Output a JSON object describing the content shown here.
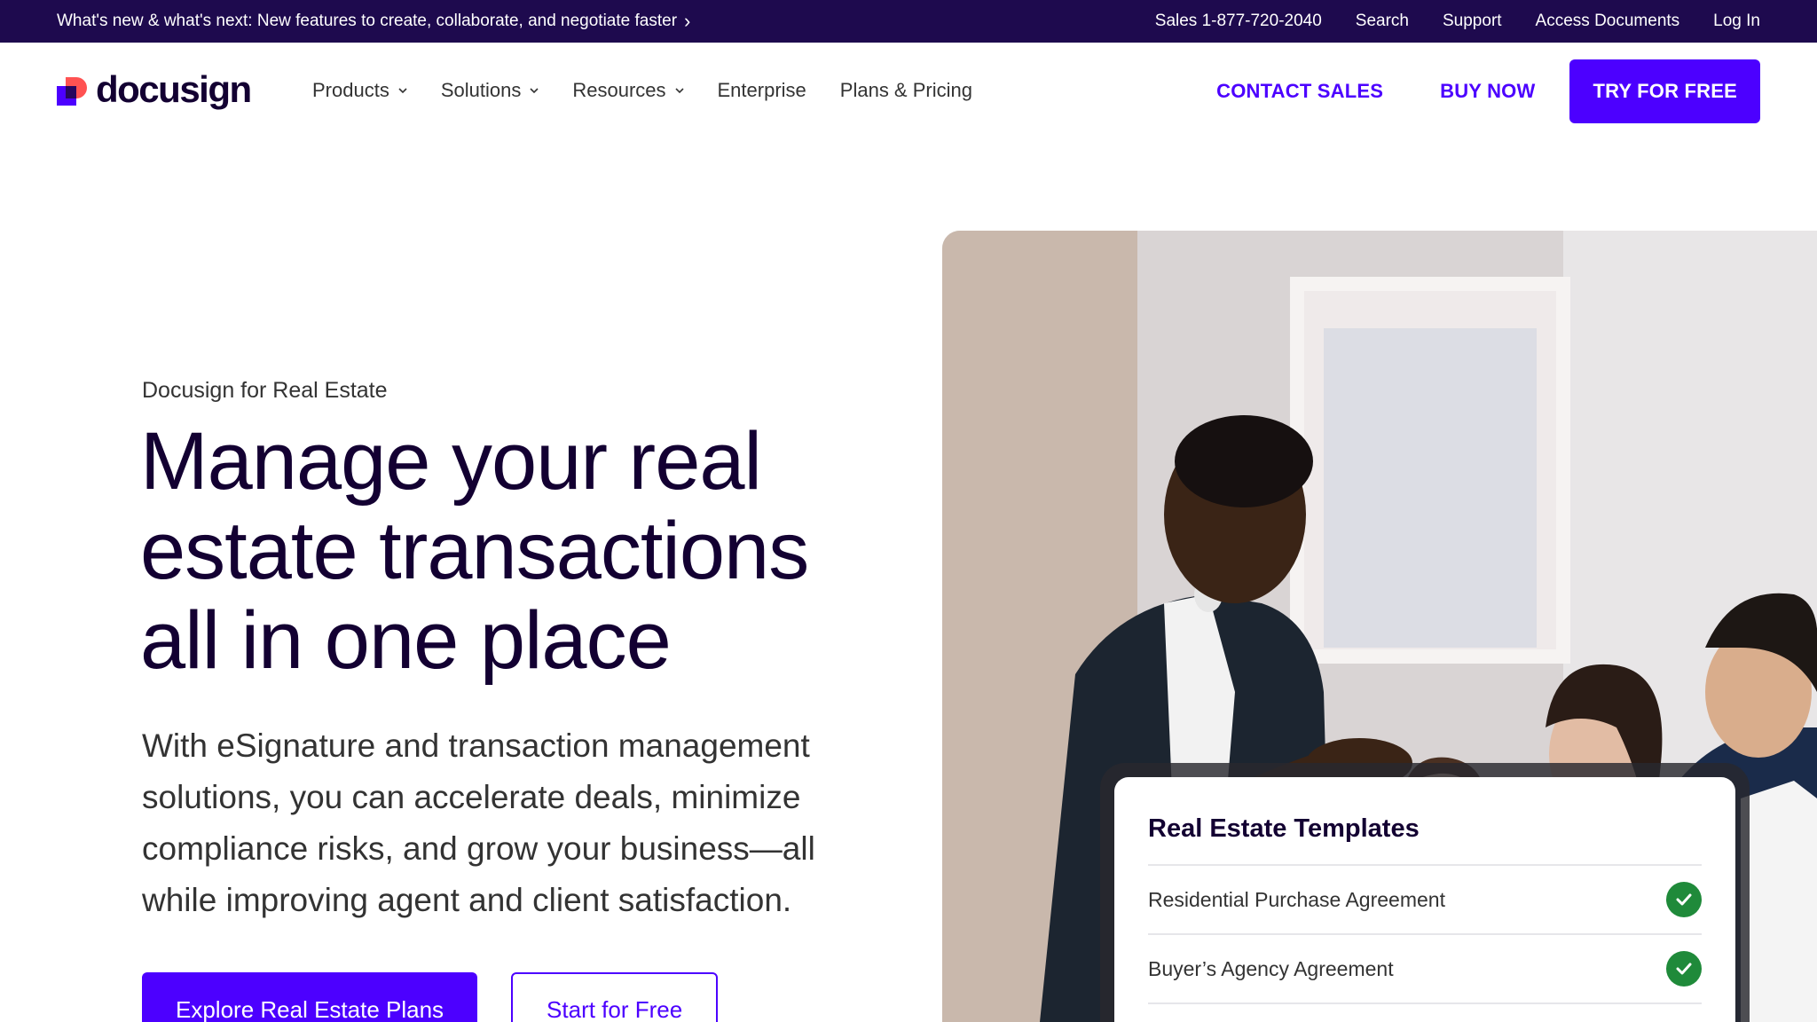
{
  "announcement": {
    "text": "What's new & what's next: New features to create, collaborate, and negotiate faster",
    "chevron": "›"
  },
  "utility_links": [
    "Sales 1-877-720-2040",
    "Search",
    "Support",
    "Access Documents",
    "Log In"
  ],
  "logo": {
    "text": "docusign"
  },
  "nav": {
    "items": [
      {
        "label": "Products",
        "dropdown": true
      },
      {
        "label": "Solutions",
        "dropdown": true
      },
      {
        "label": "Resources",
        "dropdown": true
      },
      {
        "label": "Enterprise",
        "dropdown": false
      },
      {
        "label": "Plans & Pricing",
        "dropdown": false
      }
    ],
    "contact_sales": "CONTACT SALES",
    "buy_now": "BUY NOW",
    "try_free": "TRY FOR FREE"
  },
  "hero": {
    "eyebrow": "Docusign for Real Estate",
    "headline": "Manage your real estate transactions all in one place",
    "subcopy": "With eSignature and transaction management solutions, you can accelerate deals, minimize compliance risks, and grow your business—all while improving agent and client satisfaction.",
    "cta_primary": "Explore Real Estate Plans",
    "cta_secondary": "Start for Free"
  },
  "templates_card": {
    "title": "Real Estate Templates",
    "items": [
      {
        "label": "Residential Purchase Agreement",
        "status": "check-icon"
      },
      {
        "label": "Buyer’s Agency Agreement",
        "status": "check-icon"
      }
    ]
  },
  "colors": {
    "brand": "#4c00ff",
    "topbar": "#1e0a4e",
    "ink": "#130032",
    "success": "#1f8a3a",
    "logo_red": "#ff5252"
  }
}
